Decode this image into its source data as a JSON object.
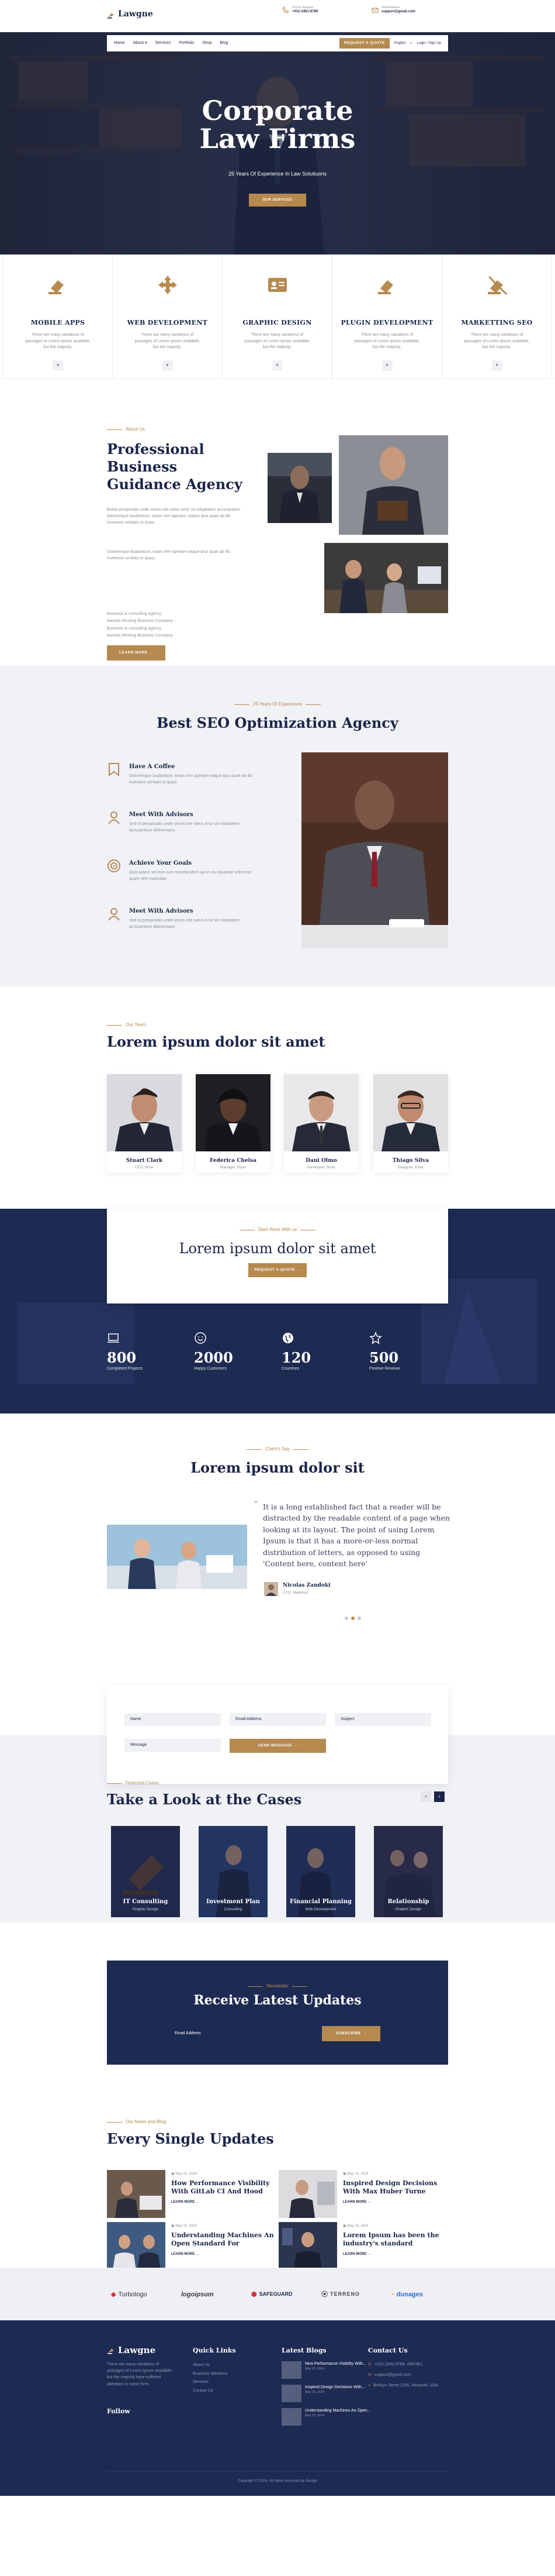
{
  "header": {
    "logo": "Lawgne",
    "phone_label": "Phone Number",
    "phone": "+012-3451-6789",
    "email_label": "Mail Address",
    "email": "support@gmail.com"
  },
  "nav": {
    "items": [
      "Home",
      "About",
      "Services",
      "Portfolio",
      "Shop",
      "Blog"
    ],
    "quote_btn": "REQUEST A QUOTE",
    "lang": "English",
    "login": "Login / Sign Up"
  },
  "hero": {
    "title_line1": "Corporate",
    "title_line2": "Law Firms",
    "subtitle": "25 Years Of Experience In Law Solutiuons",
    "button": "OUR SERVICES"
  },
  "services": [
    {
      "title": "MOBILE APPS",
      "text": "There are many variations of passages of Lorem Ipsum available, but the majority.",
      "icon": "gavel-icon"
    },
    {
      "title": "WEB DEVELOPMENT",
      "text": "There are many variations of passages of Lorem Ipsum available, but the majority.",
      "icon": "arrows-icon"
    },
    {
      "title": "GRAPHIC DESIGN",
      "text": "There are many variations of passages of Lorem Ipsum available, but the majority.",
      "icon": "id-card-icon"
    },
    {
      "title": "PLUGIN DEVELOPMENT",
      "text": "There are many variations of passages of Lorem Ipsum available, but the majority.",
      "icon": "gavel-icon"
    },
    {
      "title": "MARKETTING SEO",
      "text": "There are many variations of passages of Lorem Ipsum available, but the majority.",
      "icon": "gavel-slash-icon"
    }
  ],
  "services_more": "+",
  "about": {
    "eyebrow": "About Us",
    "title": "Professional Business Guidance Agency",
    "p1": "Belad perspiciatis unde omnis iste natus error sit voluptatem accusantium doloremque laudantium, totam rem aperiam, eaque ipsa quae ab illo inventore veritatis et quasi.",
    "p2": "Doloremque laudantium, totam rem aperiam eaque ipsa quae ab illo inventore veritatis et quasi.",
    "list": [
      "Business & consulting agency",
      "Awards Winning Business Company",
      "Business & consulting agency",
      "Awards Winning Business Company"
    ],
    "button": "LEARN MORE"
  },
  "seo": {
    "eyebrow": "25 Years Of Experience",
    "title": "Best SEO Optimization Agency",
    "features": [
      {
        "title": "Have A Coffee",
        "text": "Doloremque laudantium, totam rem aperiam eaque ipsa quae ab illo inventore veritatis et quasi."
      },
      {
        "title": "Meet With Advisors",
        "text": "Sed ut perspiciatis unde omnis iste natus error sit voluptatem accusantium doloremque."
      },
      {
        "title": "Achieve Your Goals",
        "text": "Quis autem vel eum iure reprehenderit qui in ea voluptate velit esse quam nihil molestiae."
      },
      {
        "title": "Meet With Advisors",
        "text": "Sed ut perspiciatis unde omnis iste natus error sit voluptatem accusantium doloremque."
      }
    ]
  },
  "team": {
    "eyebrow": "Our Team",
    "title": "Lorem ipsum dolor sit amet",
    "members": [
      {
        "name": "Stuart Clark",
        "role": "CEO, Rizer"
      },
      {
        "name": "Federica Chelsa",
        "role": "Manager, Rizer"
      },
      {
        "name": "Dani Olmo",
        "role": "Developer, Rizer"
      },
      {
        "name": "Thiago Silva",
        "role": "Designer, Rizer"
      }
    ]
  },
  "cta": {
    "eyebrow": "Start Work With us",
    "title": "Lorem ipsum dolor sit amet",
    "button": "REQUEST A QUOTE",
    "stats": [
      {
        "value": "800",
        "label": "Completed Projects"
      },
      {
        "value": "2000",
        "label": "Happy Customers"
      },
      {
        "value": "120",
        "label": "Countries"
      },
      {
        "value": "500",
        "label": "Positive Reviews"
      }
    ]
  },
  "testimonial": {
    "eyebrow": "Client's Say",
    "title": "Lorem ipsum dolor sit",
    "quote": "It is a long established fact that a reader will be distracted by the readable content of a page when looking at its layout. The point of using Lorem Ipsum is that it has a more-or-less normal distribution of letters, as opposed to using 'Content here, content here'",
    "name": "Nicolas Zandoki",
    "role": "CTO, Malikhan"
  },
  "form": {
    "name": "Name",
    "email": "Email Address",
    "subject": "Subject",
    "message": "Message",
    "button": "SEND MESSAGE"
  },
  "cases": {
    "eyebrow": "Featured Cases",
    "title": "Take a Look at the Cases",
    "items": [
      {
        "title": "IT Consulting",
        "sub": "Graphic Design"
      },
      {
        "title": "Investment Plan",
        "sub": "Consulting"
      },
      {
        "title": "Financial Planning",
        "sub": "Web Development"
      },
      {
        "title": "Relationship",
        "sub": "Graphic Design"
      }
    ]
  },
  "newsletter": {
    "eyebrow": "Newsletter",
    "title": "Receive Latest Updates",
    "placeholder": "Email Address",
    "button": "SUBSCRIBE"
  },
  "blog": {
    "eyebrow": "Our News and Blog",
    "title": "Every Single Updates",
    "posts": [
      {
        "date": "May 15, 2024",
        "title": "How Performance Visibility With GitLab CI And Hood",
        "more": "Learn More"
      },
      {
        "date": "May 15, 2024",
        "title": "Inspired Design Decisions With Max Huber Turne",
        "more": "Learn More"
      },
      {
        "date": "May 15, 2024",
        "title": "Understanding Machines An Open Standard For",
        "more": "Learn More"
      },
      {
        "date": "May 15, 2024",
        "title": "Lorem Ipsum has been the industry's standard",
        "more": "Learn More"
      }
    ]
  },
  "partners": [
    "Turbologo",
    "logoipsum",
    "SAFEGUARD",
    "TERRENO",
    "dunages"
  ],
  "footer": {
    "logo": "Lawgne",
    "about": "There are many variations of passages of Lorem Ipsum available, but the majority have suffered alteration in some form.",
    "follow": "Follow",
    "links_title": "Quick Links",
    "links": [
      "About Us",
      "Business Solutions",
      "Services",
      "Contact Us"
    ],
    "blog_title": "Latest Blogs",
    "blog": [
      {
        "title": "New Performance Visibility With...",
        "date": "May 15, 2024"
      },
      {
        "title": "Inspired Design Decisions With...",
        "date": "May 15, 2024"
      },
      {
        "title": "Understanding Machines An Open...",
        "date": "May 15, 2024"
      }
    ],
    "contact_title": "Contact Us",
    "contact": [
      "+012 (345) 6789, 4587951",
      "support@gmail.com",
      "Broklyn Street 1256, Newyork, USA"
    ],
    "copyright": "Copyright © 2024. All rights reserved by Design"
  }
}
